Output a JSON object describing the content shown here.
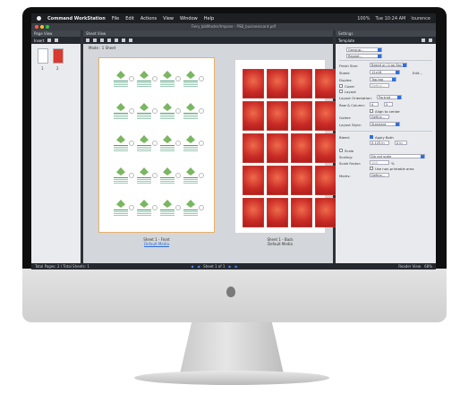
{
  "menubar": {
    "app_name": "Command WorkStation",
    "menus": [
      "File",
      "Edit",
      "Actions",
      "View",
      "Window",
      "Help"
    ],
    "status": {
      "battery": "100%",
      "clock": "Tue 10:24 AM",
      "user": "lourence"
    }
  },
  "window": {
    "title": "Fiery JobMaster/Impose - PSB_businesscard.pdf"
  },
  "page_view": {
    "header": "Page View",
    "insert_label": "Insert",
    "thumbs": [
      {
        "label": "1"
      },
      {
        "label": "2"
      }
    ]
  },
  "sheet_view": {
    "header": "Sheet View",
    "info": "Mode : 1 Sheet",
    "front": {
      "title": "Sheet 1 - Front",
      "media": "Default Media"
    },
    "back": {
      "title": "Sheet 1 - Back",
      "media": "Default Media"
    }
  },
  "navbar": {
    "totals": "Total Pages: 2 / Total Sheets: 1",
    "sheet_counter": "Sheet 1 of 1",
    "view_mode": "Reader View",
    "zoom": "68%"
  },
  "settings": {
    "header": "Settings",
    "template_label": "Template",
    "template_value": "",
    "gangup": "Gangup...",
    "repeat": "Repeat...",
    "finish_size_label": "Finish Size:",
    "finish_size_value": "Based on Crop Box",
    "sheet_label": "Sheet:",
    "sheet_value": "12x18",
    "edit_label": "Edit...",
    "duplex_label": "Duplex:",
    "duplex_value": "Top-top",
    "cover_label": "Cover",
    "cover_define": "Define...",
    "layout_label": "Layout",
    "layout_orientation_label": "Layout Orientation:",
    "layout_orientation_value": "Portrait",
    "rows_columns_label": "Row & Column:",
    "rows_value": "4",
    "columns_value": "5",
    "align_center": "Align to center",
    "gutter_label": "Gutter:",
    "gutter_define": "Define...",
    "layout_style_label": "Layout Style:",
    "layout_style_value": "Standard",
    "bleed_label": "Bleed:",
    "apply_both": "Apply Both",
    "bleed_x": "0.125 in",
    "bleed_y": "0 in",
    "scale_label": "Scale",
    "scaling_label": "Scaling:",
    "scaling_value": "Do not scale",
    "scale_factor_label": "Scale Factor:",
    "scale_factor_value": "100",
    "scale_factor_unit": "%",
    "use_printable": "Use non-printable area",
    "marks_label": "Marks:",
    "marks_define": "Define..."
  },
  "colors": {
    "back_card": "#d83a2e",
    "front_leaf": "#7bb661",
    "accent_blue": "#2f6fe0"
  }
}
